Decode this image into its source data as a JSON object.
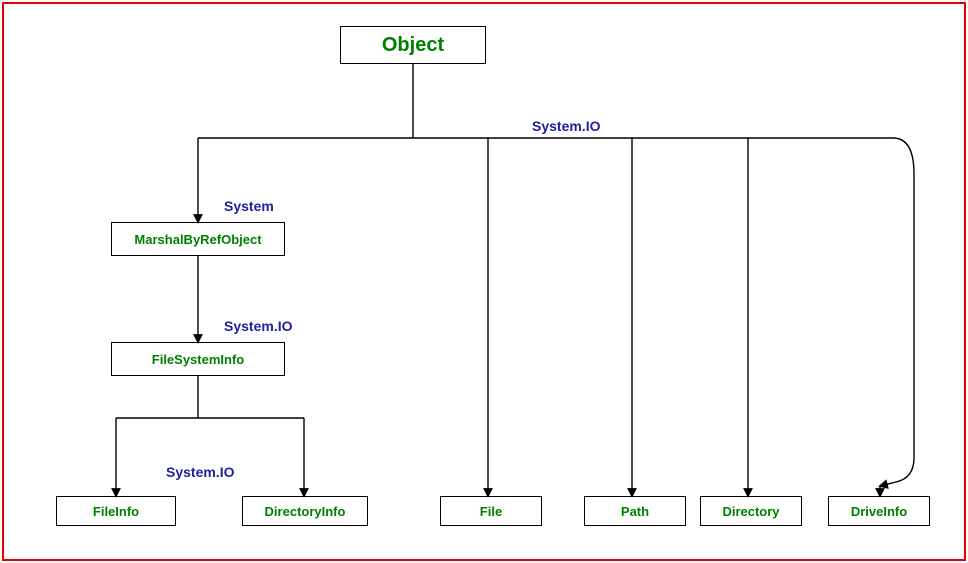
{
  "nodes": {
    "object": "Object",
    "marshal": "MarshalByRefObject",
    "fsi": "FileSystemInfo",
    "fileinfo": "FileInfo",
    "directoryinfo": "DirectoryInfo",
    "file": "File",
    "path": "Path",
    "directory": "Directory",
    "driveinfo": "DriveInfo"
  },
  "labels": {
    "systemio_top": "System.IO",
    "system_mid": "System",
    "systemio_mid": "System.IO",
    "systemio_bottom": "System.IO"
  }
}
